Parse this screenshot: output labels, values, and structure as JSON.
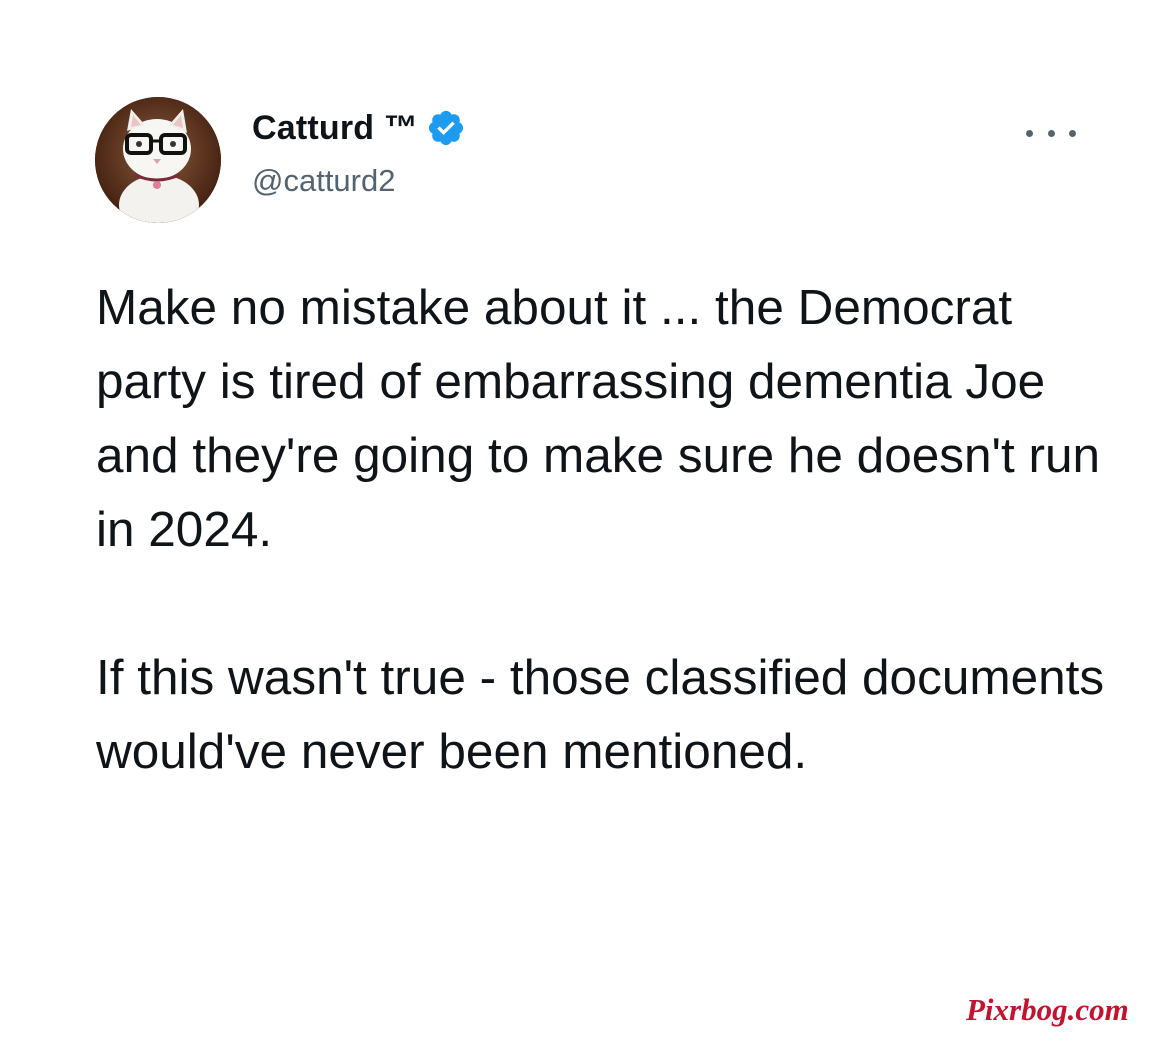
{
  "author": {
    "display_name": "Catturd ™",
    "handle": "@catturd2",
    "verified": true,
    "verified_color": "#1d9bf0",
    "avatar_icon": "cat-with-glasses-avatar"
  },
  "menu": {
    "icon": "more-horizontal-icon"
  },
  "tweet": {
    "paragraphs": [
      "Make no mistake about it ... the Democrat party is tired of embarrassing dementia Joe and they're going to make sure he doesn't run in 2024.",
      "If this wasn't true - those classified documents would've never been mentioned."
    ]
  },
  "watermark": {
    "text": "Pixrbog.com",
    "color": "#c4122f"
  }
}
